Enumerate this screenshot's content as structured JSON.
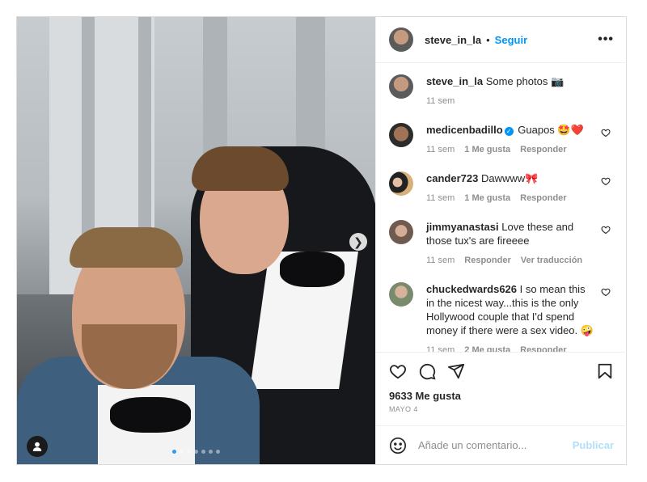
{
  "header": {
    "username": "steve_in_la",
    "separator": "•",
    "follow_label": "Seguir",
    "more_icon": "more-horizontal-icon",
    "more_glyph": "•••"
  },
  "media": {
    "carousel_slide_count": 7,
    "active_slide": 1,
    "next_glyph": "❯"
  },
  "caption": {
    "username": "steve_in_la",
    "text": "Some photos 📷",
    "time": "11 sem"
  },
  "comments": [
    {
      "username": "medicenbadillo",
      "verified": true,
      "verified_glyph": "✓",
      "text": "Guapos 🤩❤️",
      "time": "11 sem",
      "likes": "1 Me gusta",
      "reply": "Responder",
      "translate": ""
    },
    {
      "username": "cander723",
      "verified": false,
      "text": "Dawwww🎀",
      "time": "11 sem",
      "likes": "1 Me gusta",
      "reply": "Responder",
      "translate": ""
    },
    {
      "username": "jimmyanastasi",
      "verified": false,
      "text": "Love these and those tux's are fireeee",
      "time": "11 sem",
      "likes": "",
      "reply": "Responder",
      "translate": "Ver traducción"
    },
    {
      "username": "chuckedwards626",
      "verified": false,
      "text": "I so mean this in the nicest way...this is the only Hollywood couple that I'd spend money if there were a sex video. 🤪",
      "time": "11 sem",
      "likes": "2 Me gusta",
      "reply": "Responder",
      "translate": ""
    }
  ],
  "actions": {
    "likes": "9633 Me gusta",
    "date": "MAYO 4"
  },
  "add_comment": {
    "placeholder": "Añade un comentario...",
    "publish_label": "Publicar"
  },
  "colors": {
    "accent": "#0095f6",
    "publish_disabled": "#b2dffc",
    "meta": "#8e8e8e"
  }
}
